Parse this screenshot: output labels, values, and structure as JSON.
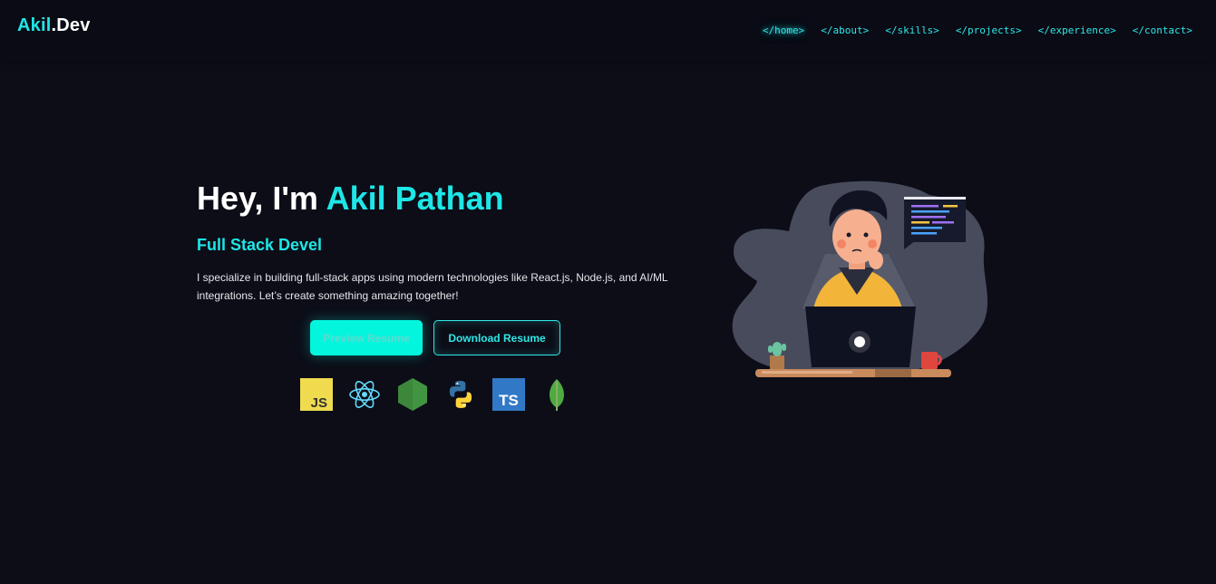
{
  "brand": {
    "accent": "Akil",
    "rest": ".Dev"
  },
  "nav": {
    "items": [
      {
        "label": "</home>",
        "active": true
      },
      {
        "label": "</about>"
      },
      {
        "label": "</skills>"
      },
      {
        "label": "</projects>"
      },
      {
        "label": "</experience>"
      },
      {
        "label": "</contact>"
      }
    ]
  },
  "hero": {
    "greeting": "Hey, I'm ",
    "name": "Akil Pathan",
    "subtitle": "Full Stack Devel",
    "description": "I specialize in building full-stack apps using modern technologies like React.js, Node.js, and AI/ML integrations. Let’s create something amazing together!",
    "preview_button": "Preview Resume",
    "download_button": "Download Resume"
  },
  "tech_icons": [
    {
      "icon": "javascript-icon",
      "label": "JS"
    },
    {
      "icon": "react-icon"
    },
    {
      "icon": "nodejs-icon"
    },
    {
      "icon": "python-icon"
    },
    {
      "icon": "typescript-icon",
      "label": "TS"
    },
    {
      "icon": "mongodb-icon"
    }
  ],
  "colors": {
    "background": "#0c0d17",
    "accent": "#1ee6e6",
    "button_fill": "#04f5dd"
  }
}
